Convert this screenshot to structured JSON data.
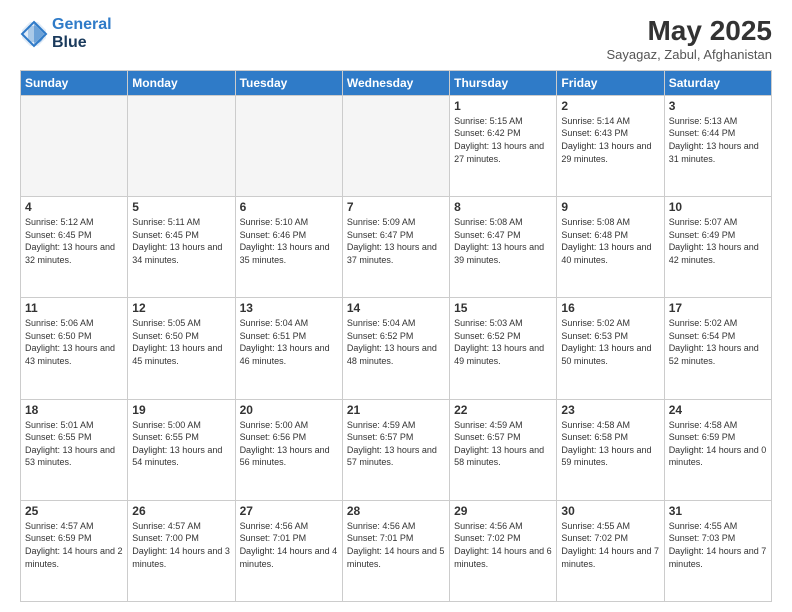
{
  "header": {
    "logo_line1": "General",
    "logo_line2": "Blue",
    "month": "May 2025",
    "location": "Sayagaz, Zabul, Afghanistan"
  },
  "weekdays": [
    "Sunday",
    "Monday",
    "Tuesday",
    "Wednesday",
    "Thursday",
    "Friday",
    "Saturday"
  ],
  "weeks": [
    [
      {
        "day": "",
        "sunrise": "",
        "sunset": "",
        "daylight": ""
      },
      {
        "day": "",
        "sunrise": "",
        "sunset": "",
        "daylight": ""
      },
      {
        "day": "",
        "sunrise": "",
        "sunset": "",
        "daylight": ""
      },
      {
        "day": "",
        "sunrise": "",
        "sunset": "",
        "daylight": ""
      },
      {
        "day": "1",
        "sunrise": "Sunrise: 5:15 AM",
        "sunset": "Sunset: 6:42 PM",
        "daylight": "Daylight: 13 hours and 27 minutes."
      },
      {
        "day": "2",
        "sunrise": "Sunrise: 5:14 AM",
        "sunset": "Sunset: 6:43 PM",
        "daylight": "Daylight: 13 hours and 29 minutes."
      },
      {
        "day": "3",
        "sunrise": "Sunrise: 5:13 AM",
        "sunset": "Sunset: 6:44 PM",
        "daylight": "Daylight: 13 hours and 31 minutes."
      }
    ],
    [
      {
        "day": "4",
        "sunrise": "Sunrise: 5:12 AM",
        "sunset": "Sunset: 6:45 PM",
        "daylight": "Daylight: 13 hours and 32 minutes."
      },
      {
        "day": "5",
        "sunrise": "Sunrise: 5:11 AM",
        "sunset": "Sunset: 6:45 PM",
        "daylight": "Daylight: 13 hours and 34 minutes."
      },
      {
        "day": "6",
        "sunrise": "Sunrise: 5:10 AM",
        "sunset": "Sunset: 6:46 PM",
        "daylight": "Daylight: 13 hours and 35 minutes."
      },
      {
        "day": "7",
        "sunrise": "Sunrise: 5:09 AM",
        "sunset": "Sunset: 6:47 PM",
        "daylight": "Daylight: 13 hours and 37 minutes."
      },
      {
        "day": "8",
        "sunrise": "Sunrise: 5:08 AM",
        "sunset": "Sunset: 6:47 PM",
        "daylight": "Daylight: 13 hours and 39 minutes."
      },
      {
        "day": "9",
        "sunrise": "Sunrise: 5:08 AM",
        "sunset": "Sunset: 6:48 PM",
        "daylight": "Daylight: 13 hours and 40 minutes."
      },
      {
        "day": "10",
        "sunrise": "Sunrise: 5:07 AM",
        "sunset": "Sunset: 6:49 PM",
        "daylight": "Daylight: 13 hours and 42 minutes."
      }
    ],
    [
      {
        "day": "11",
        "sunrise": "Sunrise: 5:06 AM",
        "sunset": "Sunset: 6:50 PM",
        "daylight": "Daylight: 13 hours and 43 minutes."
      },
      {
        "day": "12",
        "sunrise": "Sunrise: 5:05 AM",
        "sunset": "Sunset: 6:50 PM",
        "daylight": "Daylight: 13 hours and 45 minutes."
      },
      {
        "day": "13",
        "sunrise": "Sunrise: 5:04 AM",
        "sunset": "Sunset: 6:51 PM",
        "daylight": "Daylight: 13 hours and 46 minutes."
      },
      {
        "day": "14",
        "sunrise": "Sunrise: 5:04 AM",
        "sunset": "Sunset: 6:52 PM",
        "daylight": "Daylight: 13 hours and 48 minutes."
      },
      {
        "day": "15",
        "sunrise": "Sunrise: 5:03 AM",
        "sunset": "Sunset: 6:52 PM",
        "daylight": "Daylight: 13 hours and 49 minutes."
      },
      {
        "day": "16",
        "sunrise": "Sunrise: 5:02 AM",
        "sunset": "Sunset: 6:53 PM",
        "daylight": "Daylight: 13 hours and 50 minutes."
      },
      {
        "day": "17",
        "sunrise": "Sunrise: 5:02 AM",
        "sunset": "Sunset: 6:54 PM",
        "daylight": "Daylight: 13 hours and 52 minutes."
      }
    ],
    [
      {
        "day": "18",
        "sunrise": "Sunrise: 5:01 AM",
        "sunset": "Sunset: 6:55 PM",
        "daylight": "Daylight: 13 hours and 53 minutes."
      },
      {
        "day": "19",
        "sunrise": "Sunrise: 5:00 AM",
        "sunset": "Sunset: 6:55 PM",
        "daylight": "Daylight: 13 hours and 54 minutes."
      },
      {
        "day": "20",
        "sunrise": "Sunrise: 5:00 AM",
        "sunset": "Sunset: 6:56 PM",
        "daylight": "Daylight: 13 hours and 56 minutes."
      },
      {
        "day": "21",
        "sunrise": "Sunrise: 4:59 AM",
        "sunset": "Sunset: 6:57 PM",
        "daylight": "Daylight: 13 hours and 57 minutes."
      },
      {
        "day": "22",
        "sunrise": "Sunrise: 4:59 AM",
        "sunset": "Sunset: 6:57 PM",
        "daylight": "Daylight: 13 hours and 58 minutes."
      },
      {
        "day": "23",
        "sunrise": "Sunrise: 4:58 AM",
        "sunset": "Sunset: 6:58 PM",
        "daylight": "Daylight: 13 hours and 59 minutes."
      },
      {
        "day": "24",
        "sunrise": "Sunrise: 4:58 AM",
        "sunset": "Sunset: 6:59 PM",
        "daylight": "Daylight: 14 hours and 0 minutes."
      }
    ],
    [
      {
        "day": "25",
        "sunrise": "Sunrise: 4:57 AM",
        "sunset": "Sunset: 6:59 PM",
        "daylight": "Daylight: 14 hours and 2 minutes."
      },
      {
        "day": "26",
        "sunrise": "Sunrise: 4:57 AM",
        "sunset": "Sunset: 7:00 PM",
        "daylight": "Daylight: 14 hours and 3 minutes."
      },
      {
        "day": "27",
        "sunrise": "Sunrise: 4:56 AM",
        "sunset": "Sunset: 7:01 PM",
        "daylight": "Daylight: 14 hours and 4 minutes."
      },
      {
        "day": "28",
        "sunrise": "Sunrise: 4:56 AM",
        "sunset": "Sunset: 7:01 PM",
        "daylight": "Daylight: 14 hours and 5 minutes."
      },
      {
        "day": "29",
        "sunrise": "Sunrise: 4:56 AM",
        "sunset": "Sunset: 7:02 PM",
        "daylight": "Daylight: 14 hours and 6 minutes."
      },
      {
        "day": "30",
        "sunrise": "Sunrise: 4:55 AM",
        "sunset": "Sunset: 7:02 PM",
        "daylight": "Daylight: 14 hours and 7 minutes."
      },
      {
        "day": "31",
        "sunrise": "Sunrise: 4:55 AM",
        "sunset": "Sunset: 7:03 PM",
        "daylight": "Daylight: 14 hours and 7 minutes."
      }
    ]
  ]
}
